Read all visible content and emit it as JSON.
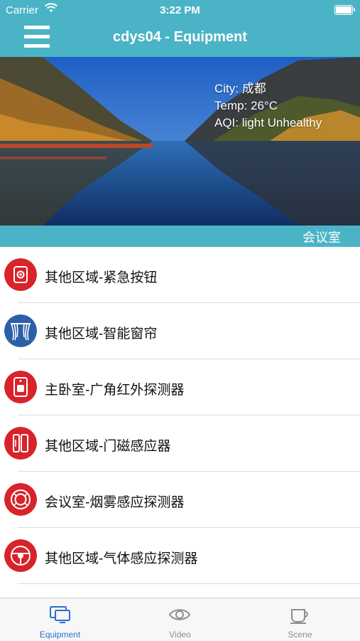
{
  "status_bar": {
    "carrier": "Carrier",
    "time": "3:22 PM"
  },
  "nav": {
    "title": "cdys04 - Equipment"
  },
  "weather": {
    "city": "City: 成都",
    "temp": "Temp: 26°C",
    "aqi": "AQI: light Unhealthy"
  },
  "room": {
    "label": "会议室"
  },
  "devices": [
    {
      "label": "其他区域-紧急按钮",
      "icon": "emergency-button-icon",
      "color": "#d8232a"
    },
    {
      "label": "其他区域-智能窗帘",
      "icon": "curtain-icon",
      "color": "#2c5fa8"
    },
    {
      "label": "主卧室-广角红外探测器",
      "icon": "infrared-detector-icon",
      "color": "#d8232a"
    },
    {
      "label": "其他区域-门磁感应器",
      "icon": "door-sensor-icon",
      "color": "#d8232a"
    },
    {
      "label": "会议室-烟雾感应探测器",
      "icon": "smoke-detector-icon",
      "color": "#d8232a"
    },
    {
      "label": "其他区域-气体感应探测器",
      "icon": "gas-detector-icon",
      "color": "#d8232a"
    }
  ],
  "tabs": [
    {
      "label": "Equipment",
      "icon": "devices-icon",
      "active": true
    },
    {
      "label": "Video",
      "icon": "eye-icon",
      "active": false
    },
    {
      "label": "Scene",
      "icon": "cup-icon",
      "active": false
    }
  ],
  "colors": {
    "header": "#4ab4c6",
    "active_tab": "#2a6fd8",
    "device_red": "#d8232a",
    "device_blue": "#2c5fa8"
  }
}
